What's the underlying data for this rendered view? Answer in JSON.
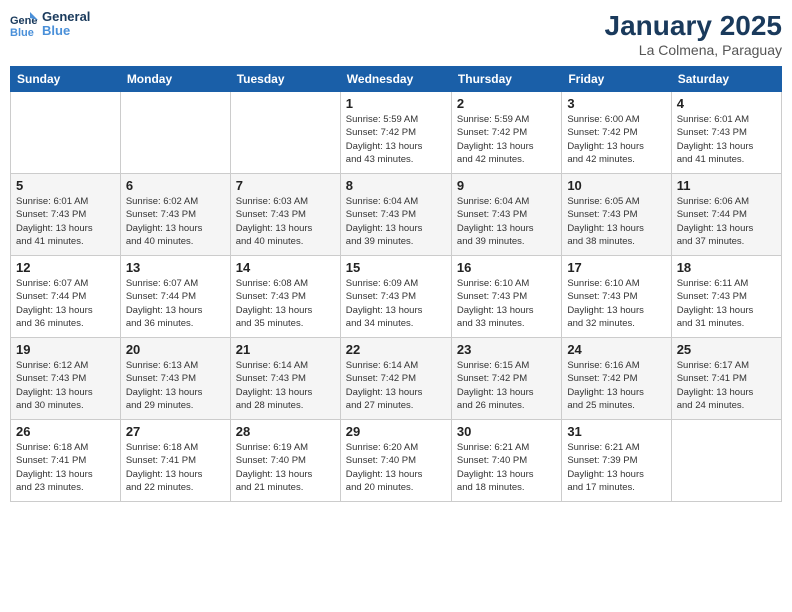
{
  "logo": {
    "line1": "General",
    "line2": "Blue"
  },
  "title": "January 2025",
  "subtitle": "La Colmena, Paraguay",
  "weekdays": [
    "Sunday",
    "Monday",
    "Tuesday",
    "Wednesday",
    "Thursday",
    "Friday",
    "Saturday"
  ],
  "weeks": [
    [
      {
        "day": "",
        "info": ""
      },
      {
        "day": "",
        "info": ""
      },
      {
        "day": "",
        "info": ""
      },
      {
        "day": "1",
        "info": "Sunrise: 5:59 AM\nSunset: 7:42 PM\nDaylight: 13 hours\nand 43 minutes."
      },
      {
        "day": "2",
        "info": "Sunrise: 5:59 AM\nSunset: 7:42 PM\nDaylight: 13 hours\nand 42 minutes."
      },
      {
        "day": "3",
        "info": "Sunrise: 6:00 AM\nSunset: 7:42 PM\nDaylight: 13 hours\nand 42 minutes."
      },
      {
        "day": "4",
        "info": "Sunrise: 6:01 AM\nSunset: 7:43 PM\nDaylight: 13 hours\nand 41 minutes."
      }
    ],
    [
      {
        "day": "5",
        "info": "Sunrise: 6:01 AM\nSunset: 7:43 PM\nDaylight: 13 hours\nand 41 minutes."
      },
      {
        "day": "6",
        "info": "Sunrise: 6:02 AM\nSunset: 7:43 PM\nDaylight: 13 hours\nand 40 minutes."
      },
      {
        "day": "7",
        "info": "Sunrise: 6:03 AM\nSunset: 7:43 PM\nDaylight: 13 hours\nand 40 minutes."
      },
      {
        "day": "8",
        "info": "Sunrise: 6:04 AM\nSunset: 7:43 PM\nDaylight: 13 hours\nand 39 minutes."
      },
      {
        "day": "9",
        "info": "Sunrise: 6:04 AM\nSunset: 7:43 PM\nDaylight: 13 hours\nand 39 minutes."
      },
      {
        "day": "10",
        "info": "Sunrise: 6:05 AM\nSunset: 7:43 PM\nDaylight: 13 hours\nand 38 minutes."
      },
      {
        "day": "11",
        "info": "Sunrise: 6:06 AM\nSunset: 7:44 PM\nDaylight: 13 hours\nand 37 minutes."
      }
    ],
    [
      {
        "day": "12",
        "info": "Sunrise: 6:07 AM\nSunset: 7:44 PM\nDaylight: 13 hours\nand 36 minutes."
      },
      {
        "day": "13",
        "info": "Sunrise: 6:07 AM\nSunset: 7:44 PM\nDaylight: 13 hours\nand 36 minutes."
      },
      {
        "day": "14",
        "info": "Sunrise: 6:08 AM\nSunset: 7:43 PM\nDaylight: 13 hours\nand 35 minutes."
      },
      {
        "day": "15",
        "info": "Sunrise: 6:09 AM\nSunset: 7:43 PM\nDaylight: 13 hours\nand 34 minutes."
      },
      {
        "day": "16",
        "info": "Sunrise: 6:10 AM\nSunset: 7:43 PM\nDaylight: 13 hours\nand 33 minutes."
      },
      {
        "day": "17",
        "info": "Sunrise: 6:10 AM\nSunset: 7:43 PM\nDaylight: 13 hours\nand 32 minutes."
      },
      {
        "day": "18",
        "info": "Sunrise: 6:11 AM\nSunset: 7:43 PM\nDaylight: 13 hours\nand 31 minutes."
      }
    ],
    [
      {
        "day": "19",
        "info": "Sunrise: 6:12 AM\nSunset: 7:43 PM\nDaylight: 13 hours\nand 30 minutes."
      },
      {
        "day": "20",
        "info": "Sunrise: 6:13 AM\nSunset: 7:43 PM\nDaylight: 13 hours\nand 29 minutes."
      },
      {
        "day": "21",
        "info": "Sunrise: 6:14 AM\nSunset: 7:43 PM\nDaylight: 13 hours\nand 28 minutes."
      },
      {
        "day": "22",
        "info": "Sunrise: 6:14 AM\nSunset: 7:42 PM\nDaylight: 13 hours\nand 27 minutes."
      },
      {
        "day": "23",
        "info": "Sunrise: 6:15 AM\nSunset: 7:42 PM\nDaylight: 13 hours\nand 26 minutes."
      },
      {
        "day": "24",
        "info": "Sunrise: 6:16 AM\nSunset: 7:42 PM\nDaylight: 13 hours\nand 25 minutes."
      },
      {
        "day": "25",
        "info": "Sunrise: 6:17 AM\nSunset: 7:41 PM\nDaylight: 13 hours\nand 24 minutes."
      }
    ],
    [
      {
        "day": "26",
        "info": "Sunrise: 6:18 AM\nSunset: 7:41 PM\nDaylight: 13 hours\nand 23 minutes."
      },
      {
        "day": "27",
        "info": "Sunrise: 6:18 AM\nSunset: 7:41 PM\nDaylight: 13 hours\nand 22 minutes."
      },
      {
        "day": "28",
        "info": "Sunrise: 6:19 AM\nSunset: 7:40 PM\nDaylight: 13 hours\nand 21 minutes."
      },
      {
        "day": "29",
        "info": "Sunrise: 6:20 AM\nSunset: 7:40 PM\nDaylight: 13 hours\nand 20 minutes."
      },
      {
        "day": "30",
        "info": "Sunrise: 6:21 AM\nSunset: 7:40 PM\nDaylight: 13 hours\nand 18 minutes."
      },
      {
        "day": "31",
        "info": "Sunrise: 6:21 AM\nSunset: 7:39 PM\nDaylight: 13 hours\nand 17 minutes."
      },
      {
        "day": "",
        "info": ""
      }
    ]
  ]
}
